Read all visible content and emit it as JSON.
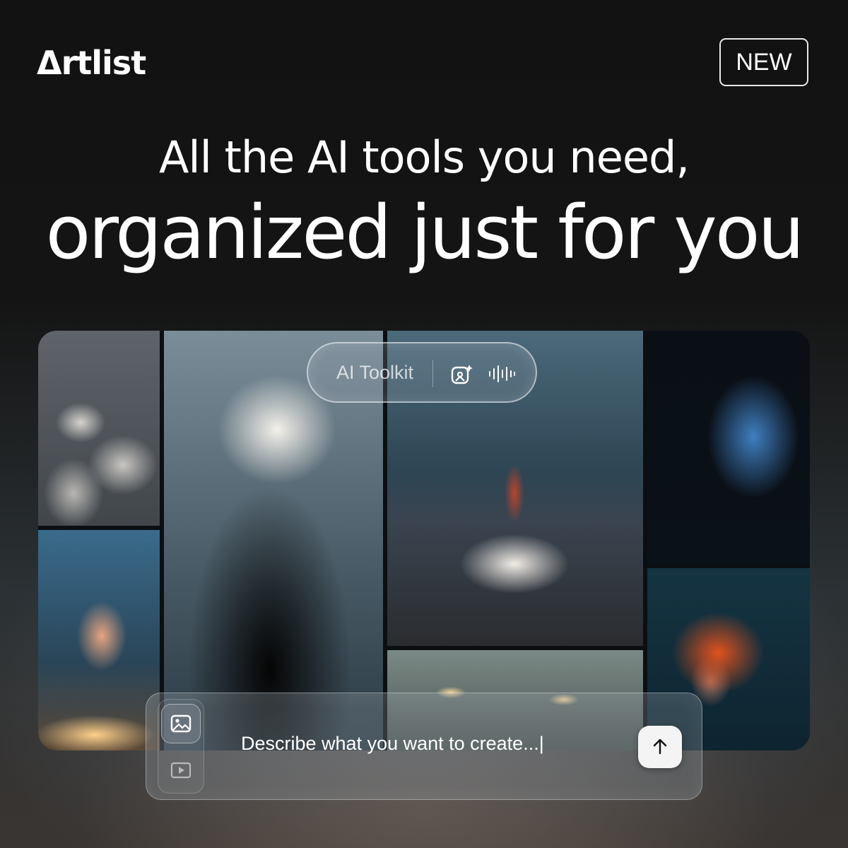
{
  "brand": {
    "logo_text": "Δrtlist"
  },
  "badge": {
    "label": "NEW"
  },
  "headline": {
    "line1": "All the AI tools you need,",
    "line2": "organized just for you"
  },
  "toolkit": {
    "label": "AI Toolkit",
    "icons": [
      "image-generation-icon",
      "audio-waveform-icon"
    ]
  },
  "gallery": {
    "images": [
      "geese",
      "woman-with-candles",
      "figure-with-glowing-tree",
      "woman-in-white-dress",
      "cars-on-road",
      "blue-horse",
      "person-in-orange-hood"
    ]
  },
  "prompt": {
    "placeholder": "Describe what you want to create...|",
    "modes": [
      "image-icon",
      "video-icon"
    ],
    "submit_icon": "arrow-up-icon"
  },
  "colors": {
    "background": "#141414",
    "text": "#ffffff",
    "submit_bg": "#f4f4f4"
  }
}
